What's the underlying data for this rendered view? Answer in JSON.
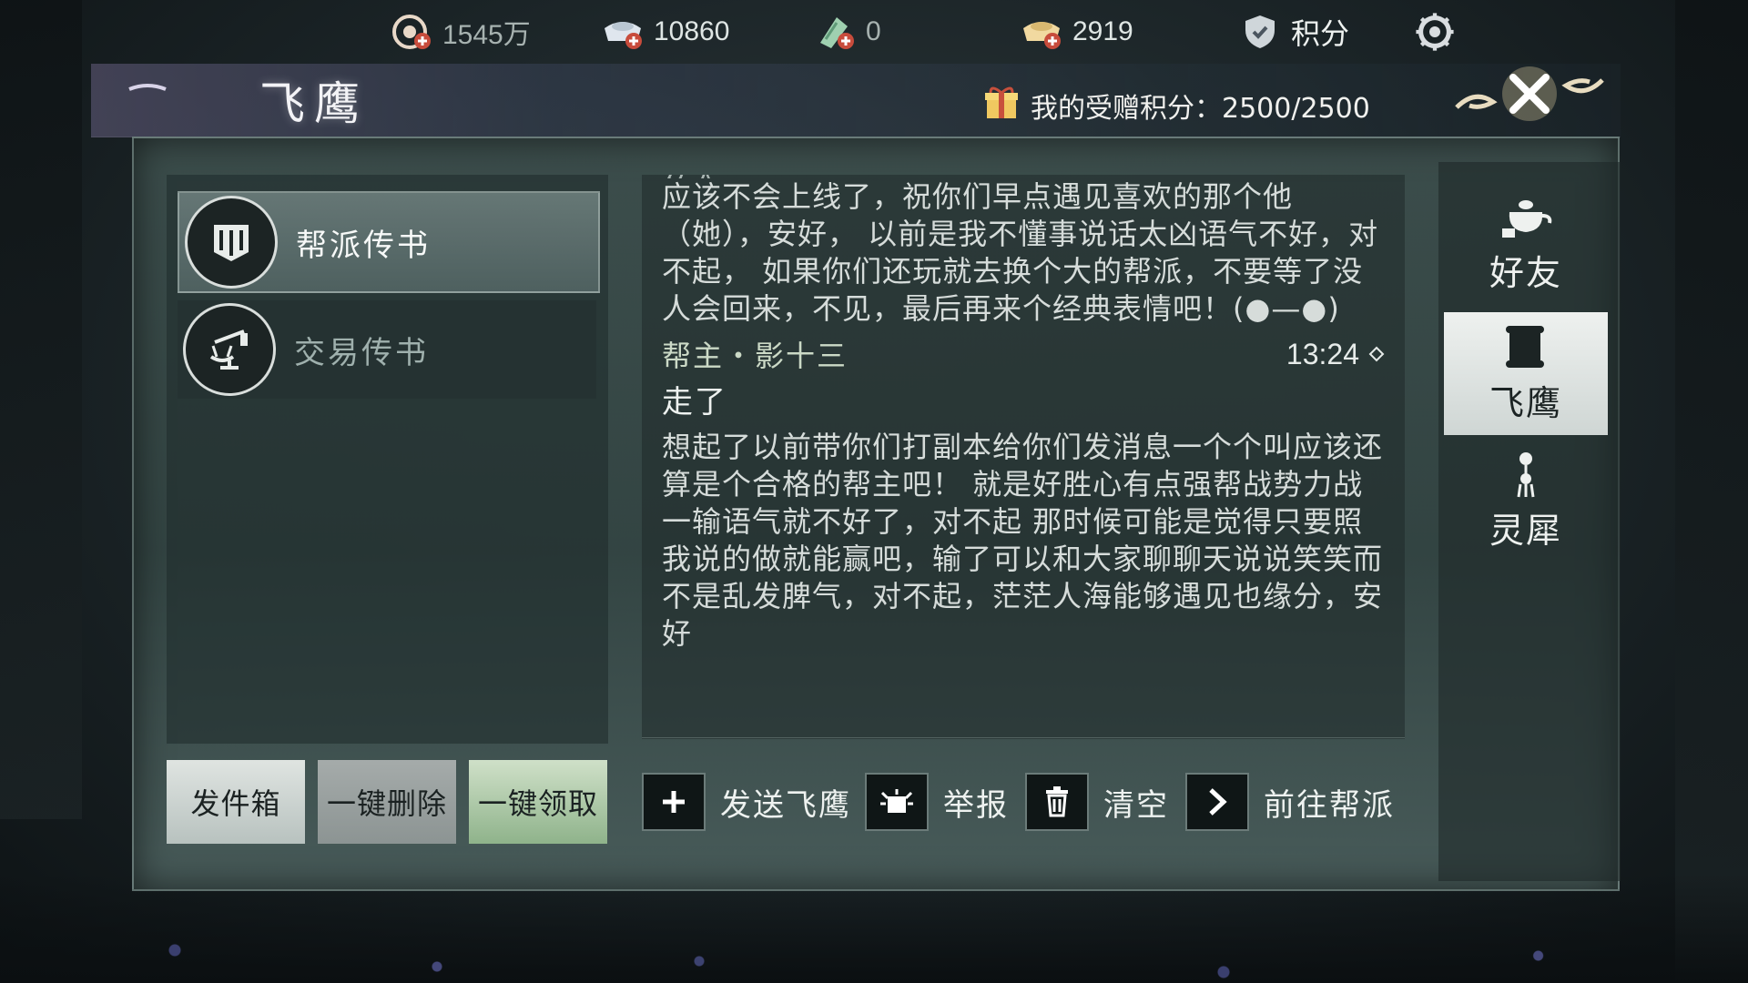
{
  "currencies": [
    {
      "icon": "coin-plus-icon",
      "value": "1545万"
    },
    {
      "icon": "silver-ingot-plus-icon",
      "value": "10860"
    },
    {
      "icon": "jade-plus-icon",
      "value": "0"
    },
    {
      "icon": "gold-ingot-plus-icon",
      "value": "2919"
    },
    {
      "icon": "points-shield-icon",
      "value": "积分"
    }
  ],
  "header": {
    "title": "飞鹰",
    "gift_points_label": "我的受赠积分：2500/2500"
  },
  "categories": [
    {
      "label": "帮派传书",
      "icon": "guild-banner-icon",
      "active": true
    },
    {
      "label": "交易传书",
      "icon": "scale-icon",
      "active": false
    }
  ],
  "left_buttons": {
    "outbox": "发件箱",
    "delete_all": "一键删除",
    "claim_all": "一键领取"
  },
  "message": {
    "cut_off_line": "女人",
    "prev_body": "应该不会上线了，祝你们早点遇见喜欢的那个他（她），安好，      以前是我不懂事说话太凶语气不好，对不起，    如果你们还玩就去换个大的帮派，不要等了没人会回来，不见，最后再来个经典表情吧！(●—●)",
    "sender": "帮主・影十三",
    "time": "13:24",
    "subject": "走了",
    "body": "想起了以前带你们打副本给你们发消息一个个叫应该还算是个合格的帮主吧！      就是好胜心有点强帮战势力战一输语气就不好了，对不起   那时候可能是觉得只要照我说的做就能赢吧，输了可以和大家聊聊天说说笑笑而不是乱发脾气，对不起，茫茫人海能够遇见也缘分，安好"
  },
  "actions": {
    "send": "发送飞鹰",
    "report": "举报",
    "clear": "清空",
    "goto_guild": "前往帮派"
  },
  "tabs": [
    {
      "label": "好友",
      "icon": "teapot-icon",
      "active": false
    },
    {
      "label": "飞鹰",
      "icon": "scroll-icon",
      "active": true
    },
    {
      "label": "灵犀",
      "icon": "tassel-icon",
      "active": false
    }
  ],
  "colors": {
    "panel": "#3e504e",
    "claim_button": "#8fb38b",
    "active_tab": "#eef1ef"
  }
}
